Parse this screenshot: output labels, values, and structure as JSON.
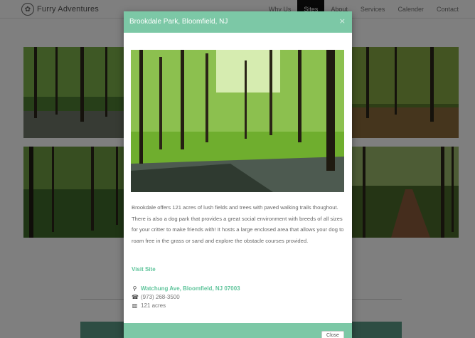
{
  "navbar": {
    "brand": "Furry Adventures",
    "items": [
      {
        "label": "Why Us",
        "active": false
      },
      {
        "label": "Sites",
        "active": true
      },
      {
        "label": "About",
        "active": false
      },
      {
        "label": "Services",
        "active": false
      },
      {
        "label": "Calender",
        "active": false
      },
      {
        "label": "Contact",
        "active": false
      }
    ]
  },
  "modal": {
    "title": "Brookdale Park, Bloomfield, NJ",
    "close_icon": "×",
    "description": "Brookdale offers 121 acres of lush fields and trees with paved walking trails thoughout. There is also a dog park that provides a great social environment with breeds of all sizes for your critter to make friends with! It hosts a large enclosed area that allows your dog to roam free in the grass or sand and explore the obstacle courses provided.",
    "visit_label": "Visit Site",
    "address": "Watchung Ave, Bloomfield, NJ 07003",
    "phone": "(973) 268-3500",
    "size": "121 acres",
    "close_button": "Close"
  },
  "icons": {
    "brand": "paw-logo-icon",
    "address": "map-marker-icon",
    "phone": "phone-icon",
    "size": "map-icon"
  },
  "colors": {
    "accent": "#7cc8a6",
    "link": "#5fc49b",
    "active_nav": "#111111"
  }
}
